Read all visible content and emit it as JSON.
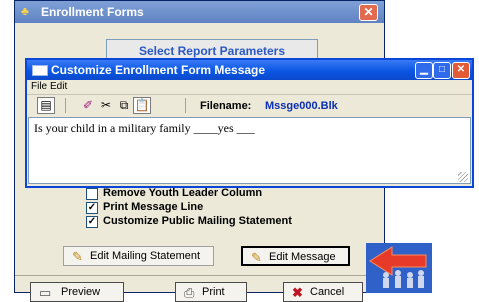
{
  "outer": {
    "title": "Enrollment Forms",
    "report_button": "Select Report Parameters",
    "checkboxes": [
      {
        "label": "Remove Youth Leader Column",
        "checked": false
      },
      {
        "label": "Print Message Line",
        "checked": true
      },
      {
        "label": "Customize Public Mailing Statement",
        "checked": true
      }
    ],
    "edit_mailing_label": "Edit Mailing Statement",
    "edit_message_label": "Edit Message",
    "preview_label": "Preview",
    "print_label": "Print",
    "cancel_label": "Cancel"
  },
  "dialog": {
    "title": "Customize Enrollment Form Message",
    "menu": {
      "file": "File",
      "edit": "Edit"
    },
    "filename_label": "Filename:",
    "filename_value": "Mssge000.Blk",
    "message_text": "Is your child in a military family ____yes ___"
  },
  "colors": {
    "accent": "#0a56e3",
    "outer_title": "#6d8fcb",
    "close": "#e35a37"
  }
}
